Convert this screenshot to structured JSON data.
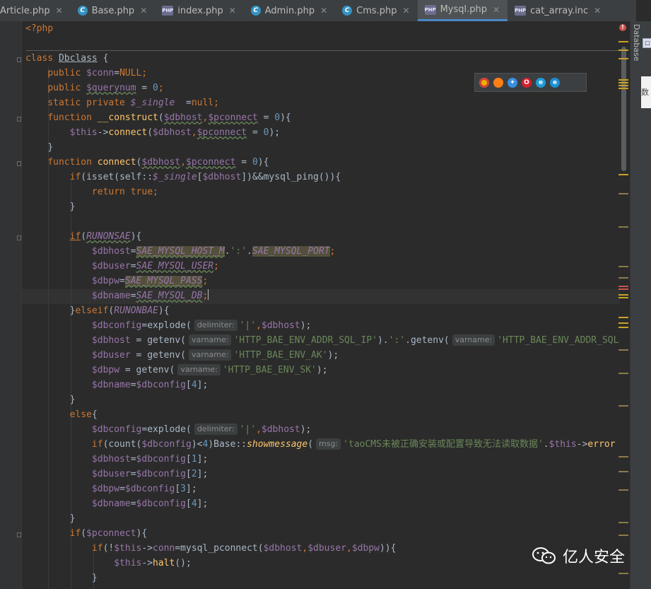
{
  "tabs": [
    {
      "label": "Article.php",
      "icon": "c-class-icon",
      "active": false
    },
    {
      "label": "Base.php",
      "icon": "c-class-icon",
      "active": false
    },
    {
      "label": "index.php",
      "icon": "php-file-icon",
      "active": false
    },
    {
      "label": "Admin.php",
      "icon": "c-class-icon",
      "active": false
    },
    {
      "label": "Cms.php",
      "icon": "c-class-icon",
      "active": false
    },
    {
      "label": "Mysql.php",
      "icon": "php-file-icon",
      "active": true
    },
    {
      "label": "cat_array.inc",
      "icon": "php-file-icon",
      "active": false
    }
  ],
  "tool_window": {
    "database_label": "Database"
  },
  "code": {
    "l1": "<?php",
    "l2a": "class",
    "l2b": "Dbclass",
    "l2c": " {",
    "l3a": "public",
    "l3b": "$conn",
    "l3c": "=",
    "l3d": "NULL",
    "l3e": ";",
    "l4a": "public",
    "l4b": "$querynum",
    "l4c": " = ",
    "l4d": "0",
    "l4e": ";",
    "l5a": "static private",
    "l5b": "$_single",
    "l5c": "  =",
    "l5d": "null",
    "l5e": ";",
    "l6a": "function",
    "l6b": "__construct",
    "l6c": "(",
    "l6d": "$dbhost",
    "l6e": ",",
    "l6f": "$pconnect",
    "l6g": " = ",
    "l6h": "0",
    "l6i": "){",
    "l7a": "$this",
    "l7b": "->",
    "l7c": "connect",
    "l7d": "(",
    "l7e": "$dbhost",
    "l7f": ",",
    "l7g": "$pconnect",
    "l7h": " = ",
    "l7i": "0",
    "l7j": ");",
    "l8": "}",
    "l9a": "function",
    "l9b": "connect",
    "l9c": "(",
    "l9d": "$dbhost",
    "l9e": ",",
    "l9f": "$pconnect",
    "l9g": " = ",
    "l9h": "0",
    "l9i": "){",
    "l10a": "if",
    "l10b": "(isset(self::",
    "l10c": "$_single",
    "l10d": "[",
    "l10e": "$dbhost",
    "l10f": "])&&mysql_ping()){",
    "l11a": "return",
    "l11b": "true",
    "l11c": ";",
    "l12": "}",
    "l14a": "if",
    "l14b": "(",
    "l14c": "RUNONSAE",
    "l14d": "){",
    "l15a": "$dbhost",
    "l15b": "=",
    "l15c": "SAE_MYSQL_HOST_M",
    "l15d": ".",
    "l15e": "':'",
    "l15f": ".",
    "l15g": "SAE_MYSQL_PORT",
    "l15h": ";",
    "l16a": "$dbuser",
    "l16b": "=",
    "l16c": "SAE_MYSQL_USER",
    "l16d": ";",
    "l17a": "$dbpw",
    "l17b": "=",
    "l17c": "SAE_MYSQL_PASS",
    "l17d": ";",
    "l18a": "$dbname",
    "l18b": "=",
    "l18c": "SAE_MYSQL_DB",
    "l18d": ";",
    "l19a": "}",
    "l19b": "elseif",
    "l19c": "(",
    "l19d": "RUNONBAE",
    "l19e": "){",
    "l20a": "$dbconfig",
    "l20b": "=explode(",
    "l20c": "delimiter:",
    "l20d": "'|'",
    "l20e": ",",
    "l20f": "$dbhost",
    "l20g": ");",
    "l21a": "$dbhost",
    "l21b": " = getenv(",
    "l21c": "varname:",
    "l21d": "'HTTP_BAE_ENV_ADDR_SQL_IP'",
    "l21e": ").",
    "l21f": "':'",
    "l21g": ".getenv(",
    "l21h": "varname:",
    "l21i": "'HTTP_BAE_ENV_ADDR_SQL",
    "l22a": "$dbuser",
    "l22b": " = getenv(",
    "l22c": "varname:",
    "l22d": "'HTTP_BAE_ENV_AK'",
    "l22e": ");",
    "l23a": "$dbpw",
    "l23b": " = getenv(",
    "l23c": "varname:",
    "l23d": "'HTTP_BAE_ENV_SK'",
    "l23e": ");",
    "l24a": "$dbname",
    "l24b": "=",
    "l24c": "$dbconfig",
    "l24d": "[",
    "l24e": "4",
    "l24f": "];",
    "l25": "}",
    "l26a": "else",
    "l26b": "{",
    "l27a": "$dbconfig",
    "l27b": "=explode(",
    "l27c": "delimiter:",
    "l27d": "'|'",
    "l27e": ",",
    "l27f": "$dbhost",
    "l27g": ");",
    "l28a": "if",
    "l28b": "(count(",
    "l28c": "$dbconfig",
    "l28d": ")<",
    "l28e": "4",
    "l28f": ")Base::",
    "l28g": "showmessage",
    "l28h": "(",
    "l28i": "msg:",
    "l28j": "'taoCMS未被正确安装或配置导致无法读取数据'",
    "l28k": ".",
    "l28l": "$this",
    "l28m": "->",
    "l28n": "error",
    "l29a": "$dbhost",
    "l29b": "=",
    "l29c": "$dbconfig",
    "l29d": "[",
    "l29e": "1",
    "l29f": "];",
    "l30a": "$dbuser",
    "l30b": "=",
    "l30c": "$dbconfig",
    "l30d": "[",
    "l30e": "2",
    "l30f": "];",
    "l31a": "$dbpw",
    "l31b": "=",
    "l31c": "$dbconfig",
    "l31d": "[",
    "l31e": "3",
    "l31f": "];",
    "l32a": "$dbname",
    "l32b": "=",
    "l32c": "$dbconfig",
    "l32d": "[",
    "l32e": "4",
    "l32f": "];",
    "l33": "}",
    "l34a": "if",
    "l34b": "(",
    "l34c": "$pconnect",
    "l34d": "){",
    "l35a": "if",
    "l35b": "(!",
    "l35c": "$this",
    "l35d": "->",
    "l35e": "conn",
    "l35f": "=mysql_pconnect(",
    "l35g": "$dbhost",
    "l35h": ",",
    "l35i": "$dbuser",
    "l35j": ",",
    "l35k": "$dbpw",
    "l35l": ")){",
    "l36a": "$this",
    "l36b": "->",
    "l36c": "halt",
    "l36d": "();",
    "l37": "}"
  },
  "browser_icons": [
    "chrome-icon",
    "firefox-icon",
    "safari-icon",
    "opera-icon",
    "ie-icon",
    "edge-icon"
  ],
  "watermark": {
    "text": "亿人安全"
  },
  "ext_panel_text": "数",
  "colors": {
    "keyword": "#cc7832",
    "variable": "#9876aa",
    "string": "#6a8759",
    "number": "#6897bb",
    "function": "#ffc66d",
    "default": "#a9b7c6",
    "accent": "#4a88c7"
  }
}
